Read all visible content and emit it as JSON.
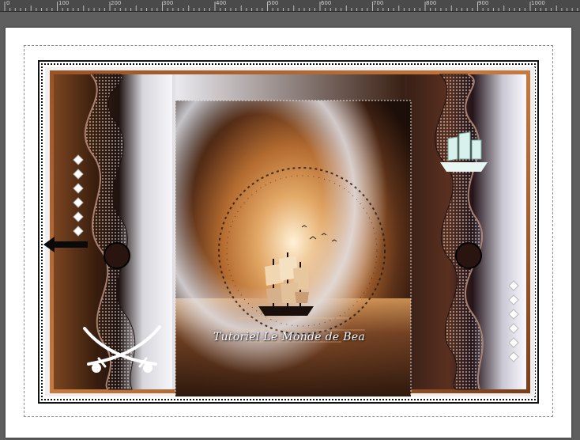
{
  "ruler": {
    "labels": [
      "0",
      "100",
      "200",
      "300",
      "400",
      "500",
      "600",
      "700",
      "800",
      "900",
      "1000"
    ]
  },
  "artwork": {
    "title": "Tutoriel Le Monde de Bea",
    "icons": [
      "crossed-sabers-icon",
      "sailing-ship-icon",
      "arrow-left-icon",
      "diamond-icon"
    ]
  },
  "colors": {
    "ruler_bg": "#4a4a4a",
    "workspace_bg": "#5e5e5e",
    "canvas_bg": "#ffffff",
    "brown_dark": "#2a160c",
    "brown_mid": "#7a4520",
    "copper": "#c67a3e"
  }
}
